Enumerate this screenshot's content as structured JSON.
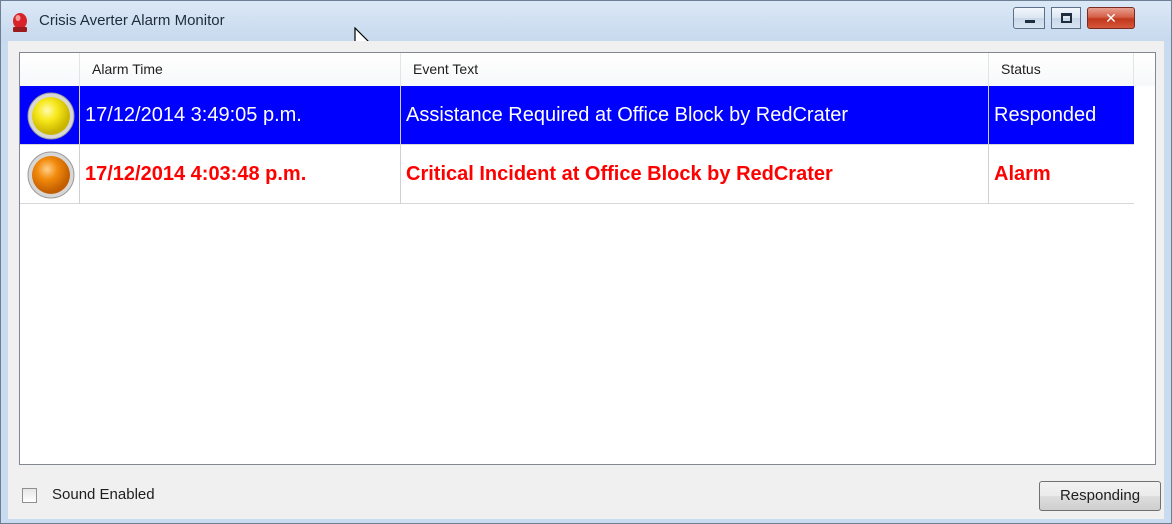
{
  "window": {
    "title": "Crisis Averter Alarm Monitor",
    "icon": "red-alarm-beacon-icon",
    "controls": [
      "minimize-icon",
      "maximize-icon",
      "close-icon"
    ],
    "close_glyph": "✕"
  },
  "table": {
    "columns": [
      "",
      "Alarm Time",
      "Event Text",
      "Status"
    ],
    "rows": [
      {
        "icon": "yellow-light-icon",
        "alarm_time": "17/12/2014 3:49:05 p.m.",
        "event_text": "Assistance Required at Office Block by RedCrater",
        "status": "Responded",
        "selected": true,
        "text_color": "#ffffff",
        "background": "#0000ff"
      },
      {
        "icon": "orange-light-icon",
        "alarm_time": "17/12/2014 4:03:48 p.m.",
        "event_text": "Critical Incident at Office Block by RedCrater",
        "status": "Alarm",
        "selected": false,
        "text_color": "#ff0000",
        "background": "#ffffff"
      }
    ]
  },
  "footer": {
    "sound_label": "Sound Enabled",
    "sound_checked": false,
    "responding_button": "Responding"
  }
}
